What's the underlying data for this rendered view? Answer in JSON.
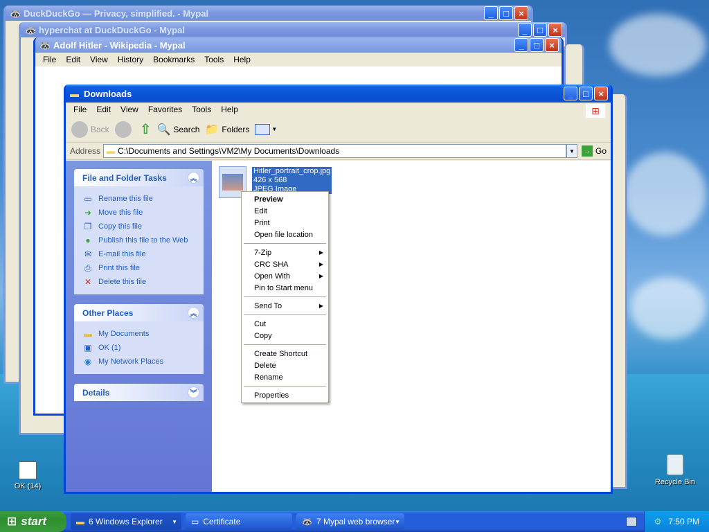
{
  "windows_background": [
    {
      "title": "DuckDuckGo — Privacy, simplified. - Mypal"
    },
    {
      "title": "hyperchat at DuckDuckGo - Mypal"
    },
    {
      "title": "Adolf Hitler - Wikipedia - Mypal"
    }
  ],
  "browser_menu": [
    "File",
    "Edit",
    "View",
    "History",
    "Bookmarks",
    "Tools",
    "Help"
  ],
  "explorer": {
    "title": "Downloads",
    "menu": [
      "File",
      "Edit",
      "View",
      "Favorites",
      "Tools",
      "Help"
    ],
    "toolbar": {
      "back": "Back",
      "search": "Search",
      "folders": "Folders"
    },
    "address_label": "Address",
    "address_value": "C:\\Documents and Settings\\VM2\\My Documents\\Downloads",
    "go_label": "Go",
    "file_tasks": {
      "header": "File and Folder Tasks",
      "items": [
        {
          "label": "Rename this file",
          "icon": "rename-icon"
        },
        {
          "label": "Move this file",
          "icon": "move-icon"
        },
        {
          "label": "Copy this file",
          "icon": "copy-icon"
        },
        {
          "label": "Publish this file to the Web",
          "icon": "globe-icon"
        },
        {
          "label": "E-mail this file",
          "icon": "email-icon"
        },
        {
          "label": "Print this file",
          "icon": "print-icon"
        },
        {
          "label": "Delete this file",
          "icon": "delete-icon"
        }
      ]
    },
    "other_places": {
      "header": "Other Places",
      "items": [
        {
          "label": "My Documents",
          "icon": "folder-icon"
        },
        {
          "label": "OK (1)",
          "icon": "computer-icon"
        },
        {
          "label": "My Network Places",
          "icon": "network-icon"
        }
      ]
    },
    "details": {
      "header": "Details"
    },
    "file": {
      "name": "Hitler_portrait_crop.jpg",
      "dimensions": "426 x 568",
      "type": "JPEG Image"
    }
  },
  "context_menu": {
    "group1": [
      "Preview",
      "Edit",
      "Print",
      "Open file location"
    ],
    "group2": [
      "7-Zip",
      "CRC SHA",
      "Open With",
      "Pin to Start menu"
    ],
    "group3": [
      "Send To"
    ],
    "group4": [
      "Cut",
      "Copy"
    ],
    "group5": [
      "Create Shortcut",
      "Delete",
      "Rename"
    ],
    "group6": [
      "Properties"
    ]
  },
  "desktop": {
    "icon_left": "OK (14)",
    "icon_right": "Recycle Bin"
  },
  "taskbar": {
    "start": "start",
    "tasks": [
      "6 Windows Explorer",
      "Certificate",
      "7 Mypal web browser"
    ],
    "clock": "7:50 PM"
  },
  "colors": {
    "xp_blue": "#0a52d6",
    "task_link": "#215dc6",
    "start_green": "#2f8f2f"
  }
}
